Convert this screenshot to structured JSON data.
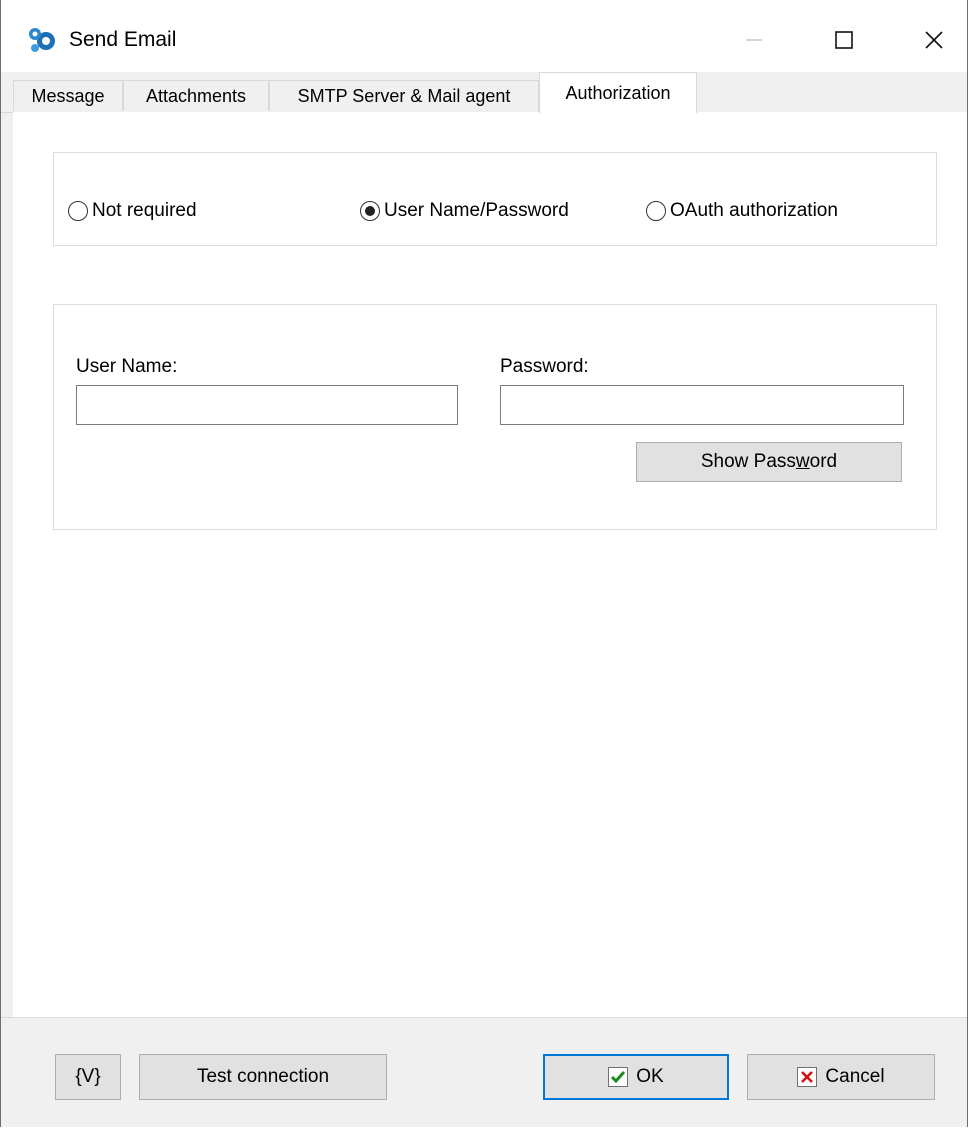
{
  "window": {
    "title": "Send Email",
    "minimize_icon": "minimize-icon",
    "maximize_icon": "maximize-icon",
    "close_icon": "close-icon"
  },
  "tabs": [
    {
      "label": "Message",
      "active": false
    },
    {
      "label": "Attachments",
      "active": false
    },
    {
      "label": "SMTP Server & Mail agent",
      "active": false
    },
    {
      "label": "Authorization",
      "active": true
    }
  ],
  "auth": {
    "options": [
      {
        "label": "Not required",
        "selected": false
      },
      {
        "label": "User Name/Password",
        "selected": true
      },
      {
        "label": "OAuth authorization",
        "selected": false
      }
    ],
    "username_label": "User Name:",
    "username_value": "",
    "password_label": "Password:",
    "password_value": "",
    "show_password_label": "Show Password",
    "show_password_mnemonic_pre": "Show Pass",
    "show_password_mnemonic_char": "w",
    "show_password_mnemonic_post": "ord"
  },
  "footer": {
    "variables_label": "{V}",
    "test_connection_label": "Test connection",
    "ok_label": "OK",
    "cancel_label": "Cancel"
  },
  "colors": {
    "accent": "#0078d7",
    "ok_check": "#1a8a1a",
    "cancel_x": "#d01010",
    "icon_blue": "#1e6fb5"
  }
}
